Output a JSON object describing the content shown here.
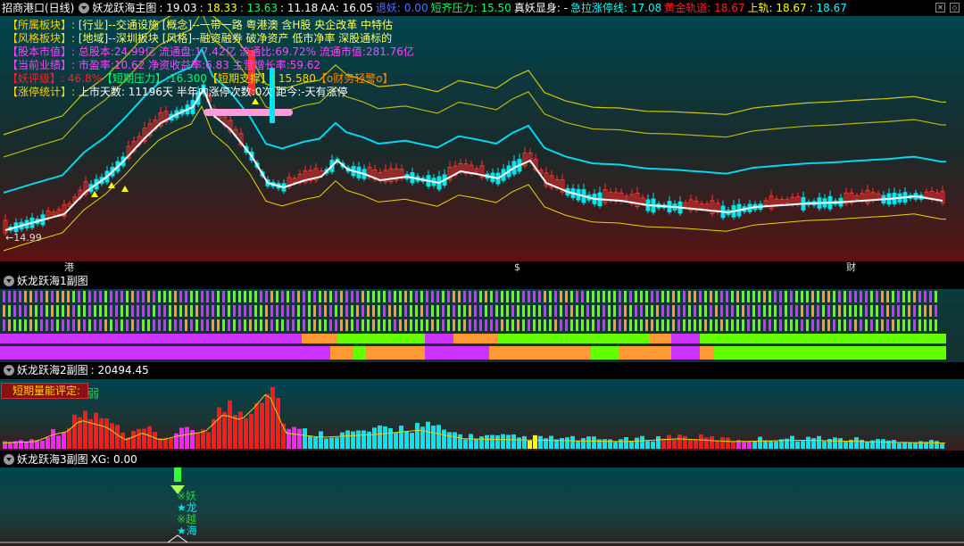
{
  "header": {
    "stock": "招商港口(日线)",
    "indicator": "妖龙跃海主图",
    "values": [
      {
        "text": ": 19.03",
        "color": "#ffffff"
      },
      {
        "text": ": 18.33",
        "color": "#ffff00"
      },
      {
        "text": ": 13.63",
        "color": "#00ff66"
      },
      {
        "text": ": 11.18",
        "color": "#ffffff"
      },
      {
        "text": "AA: 16.05",
        "color": "#ffffff"
      },
      {
        "text": "退妖: 0.00",
        "color": "#3e7bff"
      },
      {
        "text": "短齐压力: 15.50",
        "color": "#00ff66"
      },
      {
        "text": "真妖显身: -",
        "color": "#ffffff"
      },
      {
        "text": "急拉涨停线: 17.08",
        "color": "#00ffff"
      },
      {
        "text": "黄金轨道: 18.67",
        "color": "#ff2020"
      },
      {
        "text": "上轨: 18.67",
        "color": "#ffff00"
      },
      {
        "text": ": 18.67",
        "color": "#00ffff"
      }
    ]
  },
  "info_rows": [
    [
      {
        "t": "【所属板块】:",
        "c": "#ffd200"
      },
      {
        "t": " [行业]--交通设施 [概念]--一带一路 粤港澳 含H股 央企改革 中特估",
        "c": "#ffff66"
      }
    ],
    [
      {
        "t": "【风格板块】:",
        "c": "#ffd200"
      },
      {
        "t": " [地域]--深圳板块 [风格]--融资融券 破净资产 低市净率 深股通标的",
        "c": "#ffff66"
      }
    ],
    [
      {
        "t": "【股本市值】:",
        "c": "#ff44ff"
      },
      {
        "t": " 总股本:24.99亿 流通盘:17.42亿 流通比:69.72% 流通市值:281.76亿",
        "c": "#ff44ff"
      }
    ],
    [
      {
        "t": "【当前业绩】:",
        "c": "#ff44ff"
      },
      {
        "t": " 市盈率:10.62 净资收益率:6.83 主营增长率:59.62",
        "c": "#ff44ff"
      }
    ],
    [
      {
        "t": "【妖评级】:",
        "c": "#ff2020"
      },
      {
        "t": " 46.8%",
        "c": "#ff2020"
      },
      {
        "t": "【短期压力】:16.300",
        "c": "#00ff66"
      },
      {
        "t": "【短期支撑】: 15.580",
        "c": "#ffd200"
      },
      {
        "t": "【o财务轻警o】",
        "c": "#ff8800"
      }
    ],
    [
      {
        "t": "【涨停统计】:",
        "c": "#ffd200"
      },
      {
        "t": " 上市天数: 11196天 半年内涨停次数:0次   距今:-天有涨停",
        "c": "#ffffff"
      }
    ]
  ],
  "price_low_label": "←14.99",
  "x_marks": [
    {
      "t": "港",
      "c": "#2ecc40"
    },
    {
      "t": "$",
      "c": "#ff3030"
    },
    {
      "t": "财",
      "c": "#ffffff"
    }
  ],
  "sub1": {
    "title": "妖龙跃海1副图"
  },
  "sub2": {
    "title": "妖龙跃海2副图",
    "value": ": 20494.45",
    "box_label": "短期量能评定:",
    "box_value": "弱"
  },
  "sub3": {
    "title": "妖龙跃海3副图",
    "value": "XG: 0.00",
    "labels": [
      "※妖",
      "★龙",
      "※越",
      "★海"
    ]
  },
  "colors": {
    "candle_up": "#ff3030",
    "candle_down": "#00e5ee",
    "ma": "#ffffff",
    "band_cyan": "#00d8f0",
    "band_yellow": "#e6d600",
    "vol_red": "#ff1a1a",
    "vol_cyan": "#00e5ee",
    "vol_mag": "#ff22ff",
    "orange": "#ff9933",
    "green": "#66ff00",
    "magenta": "#cc33ff"
  }
}
